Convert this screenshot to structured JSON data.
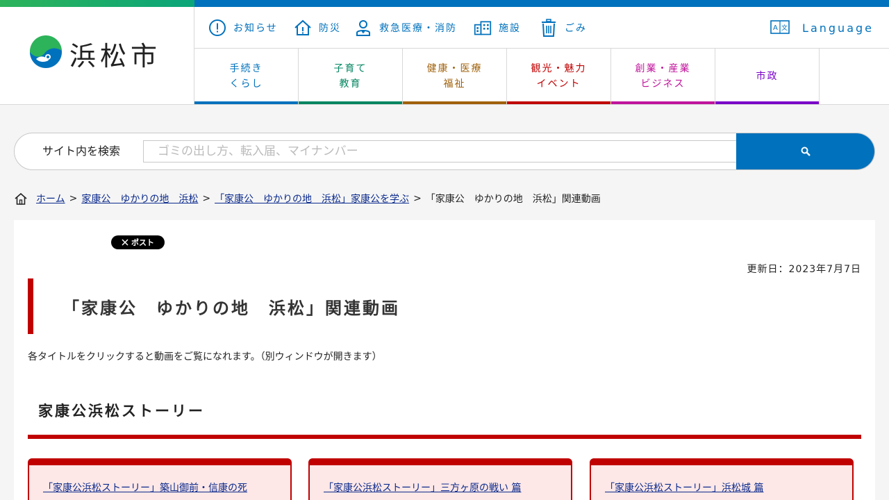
{
  "site": {
    "name": "浜松市"
  },
  "utility_nav": [
    {
      "label": "お知らせ",
      "icon": "info-circle-icon"
    },
    {
      "label": "防災",
      "icon": "house-alert-icon"
    },
    {
      "label": "救急医療・消防",
      "icon": "medical-person-icon"
    },
    {
      "label": "施設",
      "icon": "building-icon"
    },
    {
      "label": "ごみ",
      "icon": "trash-can-icon"
    }
  ],
  "language": {
    "label": "Language",
    "icon": "translate-icon"
  },
  "global_nav": [
    {
      "line1": "手続き",
      "line2": "くらし",
      "color": "#0071bc"
    },
    {
      "line1": "子育て",
      "line2": "教育",
      "color": "#00855f"
    },
    {
      "line1": "健康・医療",
      "line2": "福祉",
      "color": "#a0610b"
    },
    {
      "line1": "観光・魅力",
      "line2": "イベント",
      "color": "#c00000"
    },
    {
      "line1": "創業・産業",
      "line2": "ビジネス",
      "color": "#c0149c"
    },
    {
      "line1": "市政",
      "line2": "",
      "color": "#7a00c8"
    }
  ],
  "search": {
    "label": "サイト内を検索",
    "placeholder": "ゴミの出し方、転入届、マイナンバー",
    "button_icon": "search-icon"
  },
  "breadcrumb": {
    "home": "ホーム",
    "item1": "家康公　ゆかりの地　浜松",
    "item2": "「家康公　ゆかりの地　浜松」家康公を学ぶ",
    "current": "「家康公　ゆかりの地　浜松」関連動画",
    "separator": ">"
  },
  "page": {
    "post_button": "ポスト",
    "updated": "更新日：2023年7月7日",
    "title": "「家康公　ゆかりの地　浜松」関連動画",
    "intro": "各タイトルをクリックすると動画をご覧になれます。（別ウィンドウが開きます）",
    "section_title": "家康公浜松ストーリー",
    "cards": [
      "「家康公浜松ストーリー」築山御前・信康の死",
      "「家康公浜松ストーリー」三方ヶ原の戦い 篇",
      "「家康公浜松ストーリー」浜松城 篇"
    ]
  },
  "colors": {
    "primary": "#0071bc",
    "accent_red": "#c00000",
    "green": "#00a16b"
  }
}
